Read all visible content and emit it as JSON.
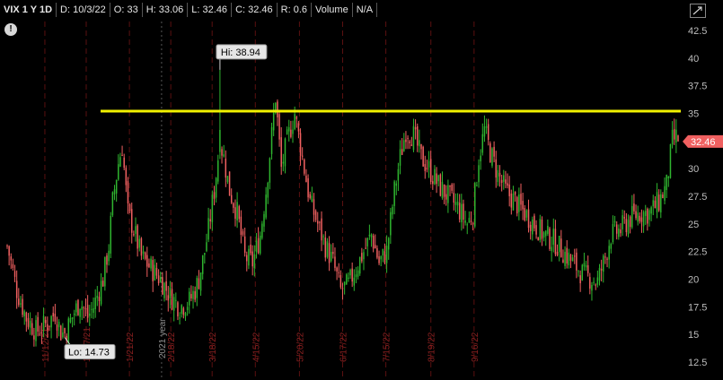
{
  "header": {
    "symbol": "VIX 1 Y 1D",
    "date": "D: 10/3/22",
    "open": "O: 33",
    "high": "H: 33.06",
    "low": "L: 32.46",
    "close": "C: 32.46",
    "range": "R: 0.6",
    "volume_label": "Volume",
    "volume_value": "N/A"
  },
  "icons": {
    "warning": "exclamation-icon",
    "expand": "expand-icon"
  },
  "warning_glyph": "!",
  "colors": {
    "up": "#2fb52f",
    "down": "#f06060",
    "resistance": "#f2f200",
    "grid": "#5a1010",
    "last_price_bg": "#f06060"
  },
  "chart_data": {
    "type": "candlestick",
    "ylim": [
      11.5,
      43.5
    ],
    "yticks": [
      "42.5",
      "40",
      "37.5",
      "35",
      "32.5",
      "30",
      "27.5",
      "25",
      "22.5",
      "20",
      "17.5",
      "15",
      "12.5"
    ],
    "date_ticks": [
      "10/15/21",
      "11/12/21",
      "12/17/21",
      "1/21/22",
      "2/18/22",
      "3/18/22",
      "4/15/22",
      "5/20/22",
      "6/17/22",
      "7/15/22",
      "8/19/22",
      "9/16/22"
    ],
    "year_label": "2021 year",
    "resistance_level": 35.2,
    "last_price": "32.46",
    "high_label": "Hi: 38.94",
    "high_value": 38.94,
    "low_label": "Lo: 14.73",
    "low_value": 14.73,
    "anchors": [
      [
        0,
        23.0
      ],
      [
        2,
        21.5
      ],
      [
        5,
        19.0
      ],
      [
        10,
        16.5
      ],
      [
        15,
        15.3
      ],
      [
        18,
        15.6
      ],
      [
        22,
        16.2
      ],
      [
        25,
        17.0
      ],
      [
        28,
        15.2
      ],
      [
        30,
        15.0
      ],
      [
        35,
        17.0
      ],
      [
        38,
        18.0
      ],
      [
        42,
        16.6
      ],
      [
        45,
        17.5
      ],
      [
        50,
        20.0
      ],
      [
        53,
        23.0
      ],
      [
        55,
        27.0
      ],
      [
        58,
        30.5
      ],
      [
        60,
        32.0
      ],
      [
        63,
        26.0
      ],
      [
        66,
        24.5
      ],
      [
        70,
        22.0
      ],
      [
        75,
        21.0
      ],
      [
        80,
        20.0
      ],
      [
        85,
        18.5
      ],
      [
        90,
        17.5
      ],
      [
        95,
        18.0
      ],
      [
        98,
        19.0
      ],
      [
        100,
        20.0
      ],
      [
        103,
        22.5
      ],
      [
        105,
        24.5
      ],
      [
        108,
        28.0
      ],
      [
        111,
        32.5
      ],
      [
        113,
        31.0
      ],
      [
        116,
        28.0
      ],
      [
        120,
        26.0
      ],
      [
        124,
        22.0
      ],
      [
        128,
        21.5
      ],
      [
        132,
        24.0
      ],
      [
        135,
        28.0
      ],
      [
        138,
        33.0
      ],
      [
        140,
        36.5
      ],
      [
        143,
        30.0
      ],
      [
        146,
        32.5
      ],
      [
        150,
        35.0
      ],
      [
        154,
        31.0
      ],
      [
        158,
        27.0
      ],
      [
        162,
        25.0
      ],
      [
        166,
        23.0
      ],
      [
        170,
        21.5
      ],
      [
        174,
        19.0
      ],
      [
        178,
        19.5
      ],
      [
        182,
        21.0
      ],
      [
        186,
        22.5
      ],
      [
        190,
        24.0
      ],
      [
        194,
        21.5
      ],
      [
        198,
        22.5
      ],
      [
        202,
        28.0
      ],
      [
        205,
        31.0
      ],
      [
        208,
        33.5
      ],
      [
        212,
        33.0
      ],
      [
        216,
        31.0
      ],
      [
        220,
        30.0
      ],
      [
        225,
        28.5
      ],
      [
        230,
        27.5
      ],
      [
        235,
        26.5
      ],
      [
        240,
        25.0
      ],
      [
        243,
        26.0
      ],
      [
        246,
        31.0
      ],
      [
        249,
        33.5
      ],
      [
        252,
        31.5
      ],
      [
        256,
        29.5
      ],
      [
        260,
        28.0
      ],
      [
        265,
        27.0
      ],
      [
        270,
        26.0
      ],
      [
        275,
        25.0
      ],
      [
        280,
        24.0
      ],
      [
        285,
        23.5
      ],
      [
        290,
        22.5
      ],
      [
        295,
        21.5
      ],
      [
        300,
        20.5
      ],
      [
        305,
        20.0
      ],
      [
        308,
        19.8
      ],
      [
        312,
        22.0
      ],
      [
        315,
        24.0
      ],
      [
        320,
        24.5
      ],
      [
        325,
        25.5
      ],
      [
        330,
        26.0
      ],
      [
        335,
        26.0
      ],
      [
        340,
        27.0
      ],
      [
        344,
        28.5
      ],
      [
        347,
        32.5
      ],
      [
        349,
        32.8
      ],
      [
        350,
        32.46
      ]
    ]
  }
}
